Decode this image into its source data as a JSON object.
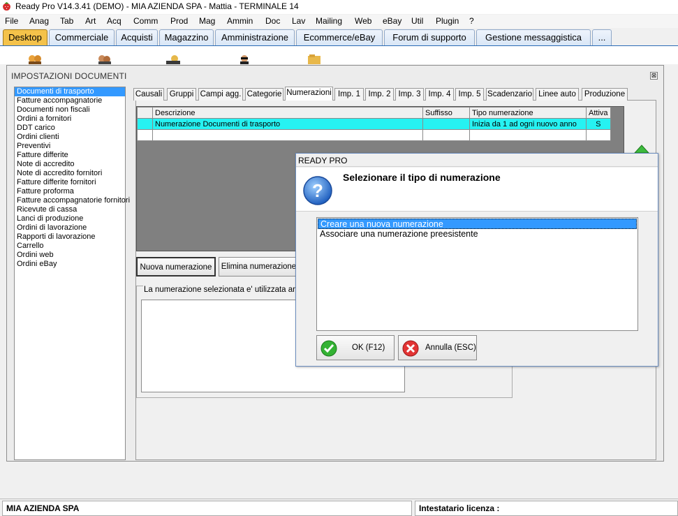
{
  "app": {
    "title": "Ready Pro V14.3.41 (DEMO)  - MIA AZIENDA SPA - Mattia - TERMINALE 14"
  },
  "menu": [
    "File",
    "Anag",
    "Tab",
    "Art",
    "Acq",
    "Comm",
    "Prod",
    "Mag",
    "Ammin",
    "Doc",
    "Lav",
    "Mailing",
    "Web",
    "eBay",
    "Util",
    "Plugin",
    "?"
  ],
  "main_tabs": [
    "Desktop",
    "Commerciale",
    "Acquisti",
    "Magazzino",
    "Amministrazione",
    "Ecommerce/eBay",
    "Forum di supporto",
    "Gestione messaggistica",
    "..."
  ],
  "active_main_tab": "Desktop",
  "window": {
    "title": "IMPOSTAZIONI DOCUMENTI",
    "close_glyph": "⊠"
  },
  "document_types": [
    "Documenti di trasporto",
    "Fatture accompagnatorie",
    "Documenti non fiscali",
    "Ordini a fornitori",
    "DDT carico",
    "Ordini clienti",
    "Preventivi",
    "Fatture differite",
    "Note di accredito",
    "Note di accredito fornitori",
    "Fatture differite fornitori",
    "Fatture proforma",
    "Fatture accompagnatorie fornitori",
    "Ricevute di cassa",
    "Lanci di produzione",
    "Ordini di lavorazione",
    "Rapporti di lavorazione",
    "Carrello",
    "Ordini web",
    "Ordini eBay"
  ],
  "selected_document_type": "Documenti di trasporto",
  "sub_tabs": [
    "Causali",
    "Gruppi",
    "Campi agg.",
    "Categorie",
    "Numerazioni",
    "Imp. 1",
    "Imp. 2",
    "Imp. 3",
    "Imp. 4",
    "Imp. 5",
    "Scadenzario",
    "Linee auto",
    "Produzione"
  ],
  "active_sub_tab": "Numerazioni",
  "grid": {
    "columns": [
      "Descrizione",
      "Suffisso",
      "Tipo numerazione",
      "Attiva"
    ],
    "rows": [
      [
        "Numerazione Documenti di trasporto",
        "",
        "Inizia da 1 ad ogni nuovo anno",
        "S"
      ]
    ]
  },
  "buttons": {
    "new_numbering": "Nuova numerazione",
    "delete_numbering": "Elimina numerazione"
  },
  "usage_group_label": "La numerazione selezionata e' utilizzata anche",
  "dialog": {
    "title": "READY PRO",
    "heading": "Selezionare il tipo di numerazione",
    "options": [
      "Creare una nuova numerazione",
      "Associare una numerazione preesistente"
    ],
    "selected_index": 0,
    "ok_label": "OK (F12)",
    "cancel_label": "Annulla (ESC)"
  },
  "status": {
    "company": "MIA AZIENDA SPA",
    "license_label": "Intestatario licenza :"
  },
  "colors": {
    "selection": "#3399ff",
    "grid_selected_row": "#26f2f2",
    "active_main_tab": "#f4c24a"
  }
}
